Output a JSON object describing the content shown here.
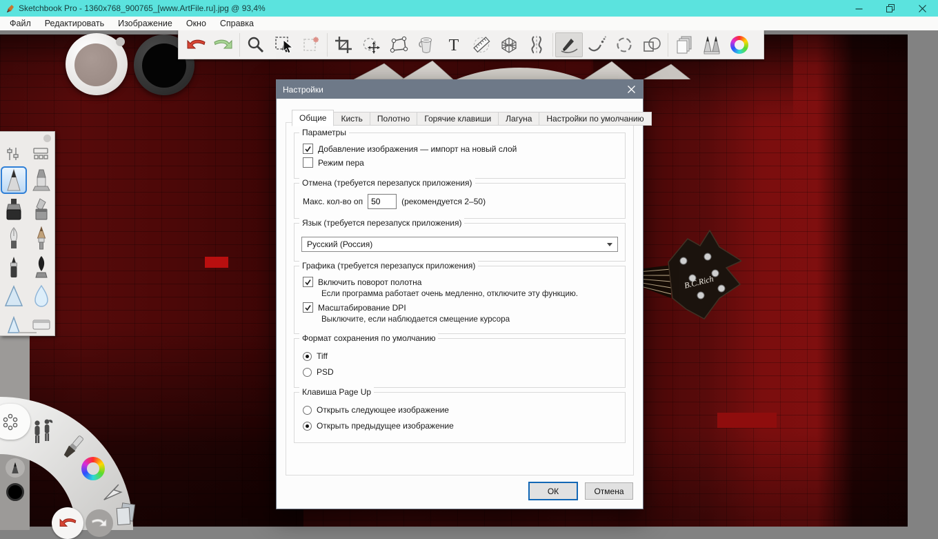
{
  "window": {
    "title": "Sketchbook Pro - 1360x768_900765_[www.ArtFile.ru].jpg @ 93,4%"
  },
  "menu": {
    "items": [
      "Файл",
      "Редактировать",
      "Изображение",
      "Окно",
      "Справка"
    ]
  },
  "toolbar": {
    "tools": [
      "undo-icon",
      "redo-icon",
      "zoom-icon",
      "select-icon",
      "deselect-icon",
      "crop-icon",
      "transform-icon",
      "distort-icon",
      "fill-icon",
      "text-icon",
      "ruler-icon",
      "perspective-icon",
      "symmetry-icon",
      "stroke-icon",
      "predictive-stroke-icon",
      "ellipse-icon",
      "shapes-icon",
      "layers-icon",
      "brushes-icon",
      "color-wheel-icon"
    ],
    "selected_tool": "stroke-icon"
  },
  "palette": {
    "brushes": [
      "pencil",
      "airbrush",
      "marker",
      "chisel-marker",
      "ballpoint-pen",
      "paintbrush",
      "felt-pen",
      "calligraphy",
      "smudge",
      "waterdrop",
      "small-smudge",
      "eraser"
    ],
    "selected_brush": "pencil"
  },
  "lagoon": {
    "icons": [
      "symmetry-icon",
      "figures-icon",
      "brush-icon",
      "color-wheel-icon",
      "cursor-icon",
      "layers-icon",
      "undo-icon",
      "redo-icon",
      "pencil-icon",
      "black-color-swatch"
    ]
  },
  "dialog": {
    "title": "Настройки",
    "tabs": [
      {
        "label": "Общие",
        "active": true
      },
      {
        "label": "Кисть",
        "active": false
      },
      {
        "label": "Полотно",
        "active": false
      },
      {
        "label": "Горячие клавиши",
        "active": false
      },
      {
        "label": "Лагуна",
        "active": false
      },
      {
        "label": "Настройки по умолчанию",
        "active": false
      }
    ],
    "parameters": {
      "legend": "Параметры",
      "items": [
        {
          "label": "Добавление изображения — импорт на новый слой",
          "checked": true
        },
        {
          "label": "Режим пера",
          "checked": false
        }
      ]
    },
    "undo": {
      "legend": "Отмена (требуется перезапуск приложения)",
      "field_label": "Макс. кол-во оп",
      "value": "50",
      "hint": "(рекомендуется 2–50)"
    },
    "language": {
      "legend": "Язык (требуется перезапуск приложения)",
      "selected": "Русский (Россия)"
    },
    "graphics": {
      "legend": "Графика (требуется перезапуск приложения)",
      "items": [
        {
          "label": "Включить поворот полотна",
          "checked": true,
          "note": "Если программа работает очень медленно, отключите эту функцию."
        },
        {
          "label": "Масштабирование DPI",
          "checked": true,
          "note": "Выключите, если наблюдается смещение курсора"
        }
      ]
    },
    "format": {
      "legend": "Формат сохранения по умолчанию",
      "options": [
        {
          "label": "Tiff",
          "selected": true
        },
        {
          "label": "PSD",
          "selected": false
        }
      ]
    },
    "pageup": {
      "legend": "Клавиша Page Up",
      "options": [
        {
          "label": "Открыть следующее изображение",
          "selected": false
        },
        {
          "label": "Открыть предыдущее изображение",
          "selected": true
        }
      ]
    },
    "buttons": {
      "ok": "ОК",
      "cancel": "Отмена"
    }
  },
  "wallpaper": {
    "guitar_logo": "B.C.Rich"
  },
  "colors": {
    "titlebar": "#5be3de",
    "dialog_header": "#6e7988",
    "focus_blue": "#1267b5",
    "canvas_red": "#4a0808",
    "pasteboard": "#828282"
  }
}
